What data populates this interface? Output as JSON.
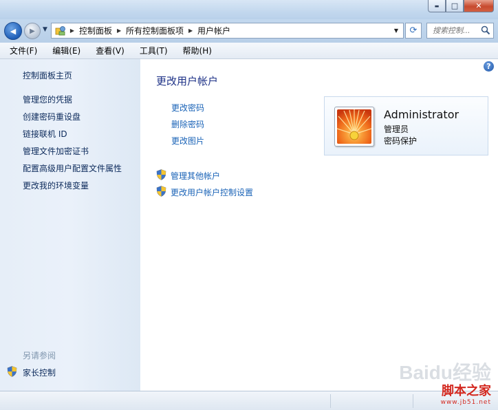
{
  "window": {
    "minimize_icon": "minimize-icon",
    "maximize_icon": "maximize-icon",
    "close_icon": "close-icon",
    "minimize_glyph": "▬",
    "maximize_glyph": "□",
    "close_glyph": "✕"
  },
  "navigation": {
    "back_glyph": "◀",
    "forward_glyph": "▶",
    "recent_glyph": "▼",
    "breadcrumb": [
      "控制面板",
      "所有控制面板项",
      "用户帐户"
    ],
    "crumb_separator": "▶",
    "dropdown_glyph": "▼",
    "refresh_glyph": "⟳",
    "search_placeholder": "搜索控制..."
  },
  "menu": [
    "文件(F)",
    "编辑(E)",
    "查看(V)",
    "工具(T)",
    "帮助(H)"
  ],
  "sidebar": {
    "items": [
      "控制面板主页",
      "管理您的凭据",
      "创建密码重设盘",
      "链接联机 ID",
      "管理文件加密证书",
      "配置高级用户配置文件属性",
      "更改我的环境变量"
    ],
    "see_also_title": "另请参阅",
    "see_also_items": [
      "家长控制"
    ]
  },
  "main": {
    "help_glyph": "?",
    "title": "更改用户帐户",
    "tasks": [
      "更改密码",
      "删除密码",
      "更改图片"
    ],
    "admin_tasks": [
      "管理其他帐户",
      "更改用户帐户控制设置"
    ]
  },
  "user": {
    "name": "Administrator",
    "role": "管理员",
    "password_status": "密码保护"
  },
  "watermark": {
    "brand": "Baidu经验",
    "site": "脚本之家",
    "url": "www.jb51.net"
  },
  "colors": {
    "link": "#1a63b7",
    "title": "#1e3287",
    "sidebar_link": "#0c2a5b",
    "close_button": "#c74a2e"
  }
}
